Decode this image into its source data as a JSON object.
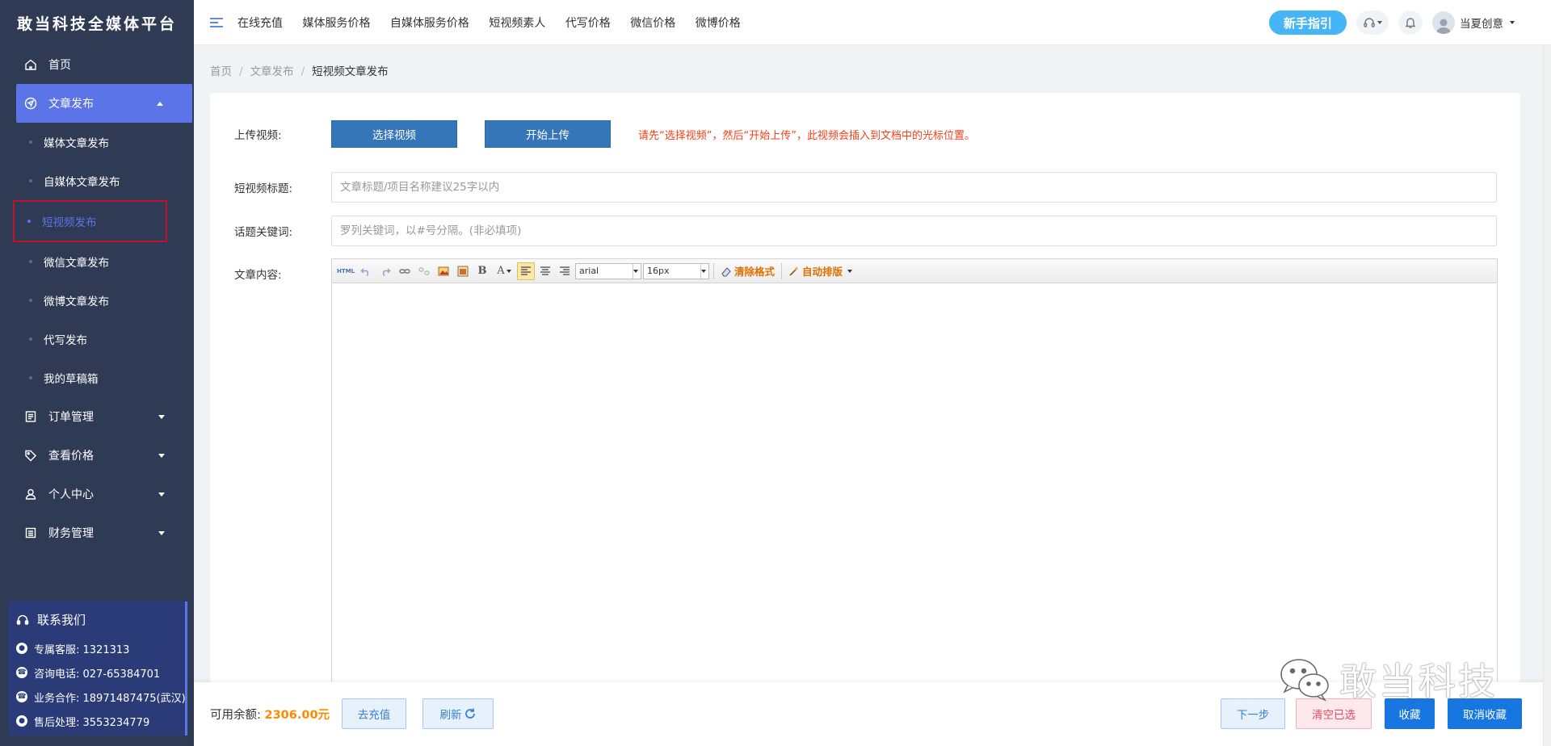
{
  "brand": "敢当科技全媒体平台",
  "topnav": [
    "在线充值",
    "媒体服务价格",
    "自媒体服务价格",
    "短视频素人",
    "代写价格",
    "微信价格",
    "微博价格"
  ],
  "guide_button": "新手指引",
  "user_name": "当夏创意",
  "sidebar": {
    "home": "首页",
    "article_publish": "文章发布",
    "sub_items": [
      "媒体文章发布",
      "自媒体文章发布",
      "短视频发布",
      "微信文章发布",
      "微博文章发布",
      "代写发布",
      "我的草稿箱"
    ],
    "orders": "订单管理",
    "prices": "查看价格",
    "personal": "个人中心",
    "finance": "财务管理"
  },
  "contact": {
    "title": "联系我们",
    "rows": [
      "专属客服: 1321313",
      "咨询电话: 027-65384701",
      "业务合作: 18971487475(武汉)",
      "售后处理: 3553234779"
    ]
  },
  "breadcrumb": [
    "首页",
    "文章发布",
    "短视频文章发布"
  ],
  "form": {
    "upload_label": "上传视频:",
    "select_video": "选择视频",
    "start_upload": "开始上传",
    "upload_hint": "请先“选择视频”，然后“开始上传”，此视频会插入到文档中的光标位置。",
    "title_label": "短视频标题:",
    "title_placeholder": "文章标题/项目名称建议25字以内",
    "keywords_label": "话题关键词:",
    "keywords_placeholder": "罗列关键词，以#号分隔。(非必填项)",
    "content_label": "文章内容:"
  },
  "editor": {
    "html": "HTML",
    "bold": "B",
    "fontcolor": "A",
    "font": "arial",
    "size": "16px",
    "clear_format": "清除格式",
    "auto_layout": "自动排版"
  },
  "bottom": {
    "balance_label": "可用余额:",
    "balance_value": "2306.00元",
    "recharge": "去充值",
    "refresh": "刷新",
    "next": "下一步",
    "clear": "清空已选",
    "favorite": "收藏",
    "unfavorite": "取消收藏"
  },
  "watermark": "敢当科技",
  "colors": {
    "sidebar_bg": "#2f3b55",
    "accent": "#5b74e8",
    "button_blue": "#3576b9",
    "hint_red": "#ff3c14",
    "balance_orange": "#ff8a00"
  }
}
